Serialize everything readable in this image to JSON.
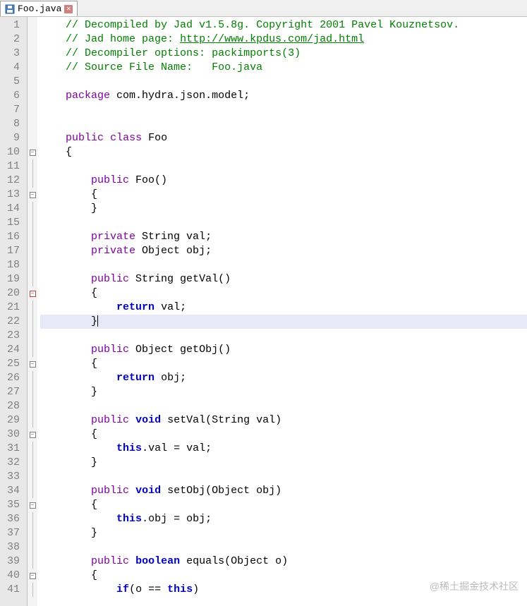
{
  "tab": {
    "filename": "Foo.java"
  },
  "watermark": "@稀土掘金技术社区",
  "lines": [
    {
      "n": 1,
      "fold": "",
      "segs": [
        [
          "",
          "    "
        ],
        [
          "comment",
          "// Decompiled by Jad v1.5.8g. Copyright 2001 Pavel Kouznetsov."
        ]
      ]
    },
    {
      "n": 2,
      "fold": "",
      "segs": [
        [
          "",
          "    "
        ],
        [
          "comment",
          "// Jad home page: "
        ],
        [
          "link",
          "http://www.kpdus.com/jad.html"
        ]
      ]
    },
    {
      "n": 3,
      "fold": "",
      "segs": [
        [
          "",
          "    "
        ],
        [
          "comment",
          "// Decompiler options: packimports(3) "
        ]
      ]
    },
    {
      "n": 4,
      "fold": "",
      "segs": [
        [
          "",
          "    "
        ],
        [
          "comment",
          "// Source File Name:   Foo.java"
        ]
      ]
    },
    {
      "n": 5,
      "fold": "",
      "segs": []
    },
    {
      "n": 6,
      "fold": "",
      "segs": [
        [
          "",
          "    "
        ],
        [
          "keyword2",
          "package"
        ],
        [
          "",
          " com.hydra.json.model;"
        ]
      ]
    },
    {
      "n": 7,
      "fold": "",
      "segs": []
    },
    {
      "n": 8,
      "fold": "",
      "segs": []
    },
    {
      "n": 9,
      "fold": "",
      "segs": [
        [
          "",
          "    "
        ],
        [
          "keyword2",
          "public"
        ],
        [
          "",
          " "
        ],
        [
          "keyword2",
          "class"
        ],
        [
          "",
          " Foo"
        ]
      ]
    },
    {
      "n": 10,
      "fold": "box",
      "segs": [
        [
          "",
          "    {"
        ]
      ]
    },
    {
      "n": 11,
      "fold": "line",
      "segs": []
    },
    {
      "n": 12,
      "fold": "line",
      "segs": [
        [
          "",
          "        "
        ],
        [
          "keyword2",
          "public"
        ],
        [
          "",
          " Foo()"
        ]
      ]
    },
    {
      "n": 13,
      "fold": "box",
      "segs": [
        [
          "",
          "        {"
        ]
      ]
    },
    {
      "n": 14,
      "fold": "line",
      "segs": [
        [
          "",
          "        }"
        ]
      ]
    },
    {
      "n": 15,
      "fold": "line",
      "segs": []
    },
    {
      "n": 16,
      "fold": "line",
      "segs": [
        [
          "",
          "        "
        ],
        [
          "keyword2",
          "private"
        ],
        [
          "",
          " String val;"
        ]
      ]
    },
    {
      "n": 17,
      "fold": "line",
      "segs": [
        [
          "",
          "        "
        ],
        [
          "keyword2",
          "private"
        ],
        [
          "",
          " Object obj;"
        ]
      ]
    },
    {
      "n": 18,
      "fold": "line",
      "segs": []
    },
    {
      "n": 19,
      "fold": "line",
      "segs": [
        [
          "",
          "        "
        ],
        [
          "keyword2",
          "public"
        ],
        [
          "",
          " String getVal()"
        ]
      ]
    },
    {
      "n": 20,
      "fold": "boxr",
      "segs": [
        [
          "",
          "        {"
        ]
      ]
    },
    {
      "n": 21,
      "fold": "line",
      "segs": [
        [
          "",
          "            "
        ],
        [
          "keyword",
          "return"
        ],
        [
          "",
          " val;"
        ]
      ]
    },
    {
      "n": 22,
      "fold": "line",
      "hl": true,
      "cursor": true,
      "segs": [
        [
          "",
          "        }"
        ]
      ]
    },
    {
      "n": 23,
      "fold": "line",
      "segs": []
    },
    {
      "n": 24,
      "fold": "line",
      "segs": [
        [
          "",
          "        "
        ],
        [
          "keyword2",
          "public"
        ],
        [
          "",
          " Object getObj()"
        ]
      ]
    },
    {
      "n": 25,
      "fold": "box",
      "segs": [
        [
          "",
          "        {"
        ]
      ]
    },
    {
      "n": 26,
      "fold": "line",
      "segs": [
        [
          "",
          "            "
        ],
        [
          "keyword",
          "return"
        ],
        [
          "",
          " obj;"
        ]
      ]
    },
    {
      "n": 27,
      "fold": "line",
      "segs": [
        [
          "",
          "        }"
        ]
      ]
    },
    {
      "n": 28,
      "fold": "line",
      "segs": []
    },
    {
      "n": 29,
      "fold": "line",
      "segs": [
        [
          "",
          "        "
        ],
        [
          "keyword2",
          "public"
        ],
        [
          "",
          " "
        ],
        [
          "keyword",
          "void"
        ],
        [
          "",
          " setVal(String val)"
        ]
      ]
    },
    {
      "n": 30,
      "fold": "box",
      "segs": [
        [
          "",
          "        {"
        ]
      ]
    },
    {
      "n": 31,
      "fold": "line",
      "segs": [
        [
          "",
          "            "
        ],
        [
          "keyword",
          "this"
        ],
        [
          "",
          ".val = val;"
        ]
      ]
    },
    {
      "n": 32,
      "fold": "line",
      "segs": [
        [
          "",
          "        }"
        ]
      ]
    },
    {
      "n": 33,
      "fold": "line",
      "segs": []
    },
    {
      "n": 34,
      "fold": "line",
      "segs": [
        [
          "",
          "        "
        ],
        [
          "keyword2",
          "public"
        ],
        [
          "",
          " "
        ],
        [
          "keyword",
          "void"
        ],
        [
          "",
          " setObj(Object obj)"
        ]
      ]
    },
    {
      "n": 35,
      "fold": "box",
      "segs": [
        [
          "",
          "        {"
        ]
      ]
    },
    {
      "n": 36,
      "fold": "line",
      "segs": [
        [
          "",
          "            "
        ],
        [
          "keyword",
          "this"
        ],
        [
          "",
          ".obj = obj;"
        ]
      ]
    },
    {
      "n": 37,
      "fold": "line",
      "segs": [
        [
          "",
          "        }"
        ]
      ]
    },
    {
      "n": 38,
      "fold": "line",
      "segs": []
    },
    {
      "n": 39,
      "fold": "line",
      "segs": [
        [
          "",
          "        "
        ],
        [
          "keyword2",
          "public"
        ],
        [
          "",
          " "
        ],
        [
          "keyword",
          "boolean"
        ],
        [
          "",
          " equals(Object o)"
        ]
      ]
    },
    {
      "n": 40,
      "fold": "box",
      "segs": [
        [
          "",
          "        {"
        ]
      ]
    },
    {
      "n": 41,
      "fold": "line",
      "segs": [
        [
          "",
          "            "
        ],
        [
          "keyword",
          "if"
        ],
        [
          "",
          "(o == "
        ],
        [
          "keyword",
          "this"
        ],
        [
          "",
          ")"
        ]
      ]
    }
  ]
}
